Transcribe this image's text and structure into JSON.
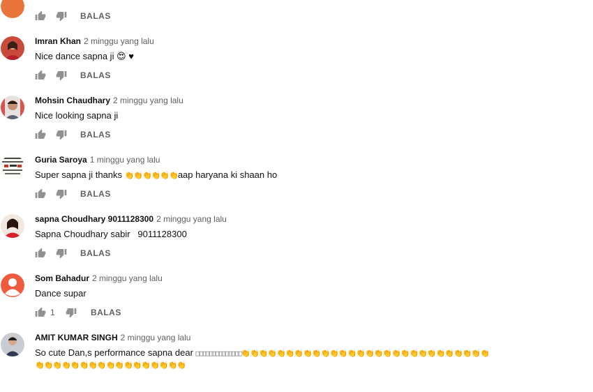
{
  "reply_label": "BALAS",
  "top_partial": {
    "avatar_color": "#e8743b"
  },
  "comments": [
    {
      "author": "Imran Khan",
      "time": "2 minggu yang lalu",
      "text": "Nice dance sapna ji 😍 ♥",
      "avatar": "photo-woman-red",
      "likes": ""
    },
    {
      "author": "Mohsin Chaudhary",
      "time": "2 minggu yang lalu",
      "text": "Nice looking sapna ji",
      "avatar": "photo-man",
      "likes": ""
    },
    {
      "author": "Guria Saroya",
      "time": "1 minggu yang lalu",
      "text_before": "Super sapna ji thanks ",
      "claps_1": "👏👏👏👏👏👏",
      "text_after": "aap haryana ki shaan ho",
      "avatar": "text-image",
      "likes": ""
    },
    {
      "author": "sapna Choudhary 9011128300",
      "time": "2 minggu yang lalu",
      "text": "Sapna Choudhary sabir   9011128300",
      "avatar": "photo-woman-red",
      "likes": ""
    },
    {
      "author": "Som Bahadur",
      "time": "2 minggu yang lalu",
      "text": "Dance supar",
      "avatar": "default-orange",
      "avatar_color": "#ef5a3c",
      "likes": "1"
    },
    {
      "author": "AMIT KUMAR SINGH",
      "time": "2 minggu yang lalu",
      "text_before": "So cute Dan,s performance sapna dear ",
      "boxes": "□□□□□□□□□□□□□□",
      "claps_1": "👏👏👏👏👏👏👏👏👏👏👏👏👏👏👏👏👏👏👏👏👏👏👏👏👏👏👏👏",
      "claps_2": "👏👏👏👏👏👏👏👏👏👏👏👏👏👏👏👏👏",
      "avatar": "photo-child",
      "likes": ""
    }
  ]
}
